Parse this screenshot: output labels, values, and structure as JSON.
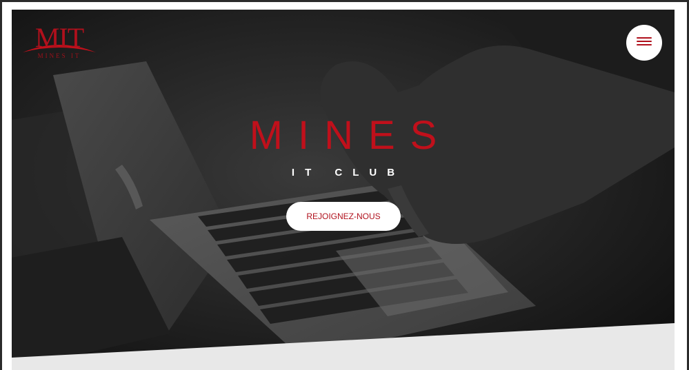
{
  "logo": {
    "main": "MIT",
    "sub": "MINES IT"
  },
  "hero": {
    "title": "MINES",
    "subtitle": "IT CLUB",
    "cta_label": "REJOIGNEZ-NOUS"
  },
  "menu": {
    "icon": "hamburger-menu-icon"
  },
  "colors": {
    "brand_red": "#c0101b",
    "hero_overlay": "#141414",
    "band": "#e8e8e8",
    "white": "#ffffff"
  }
}
